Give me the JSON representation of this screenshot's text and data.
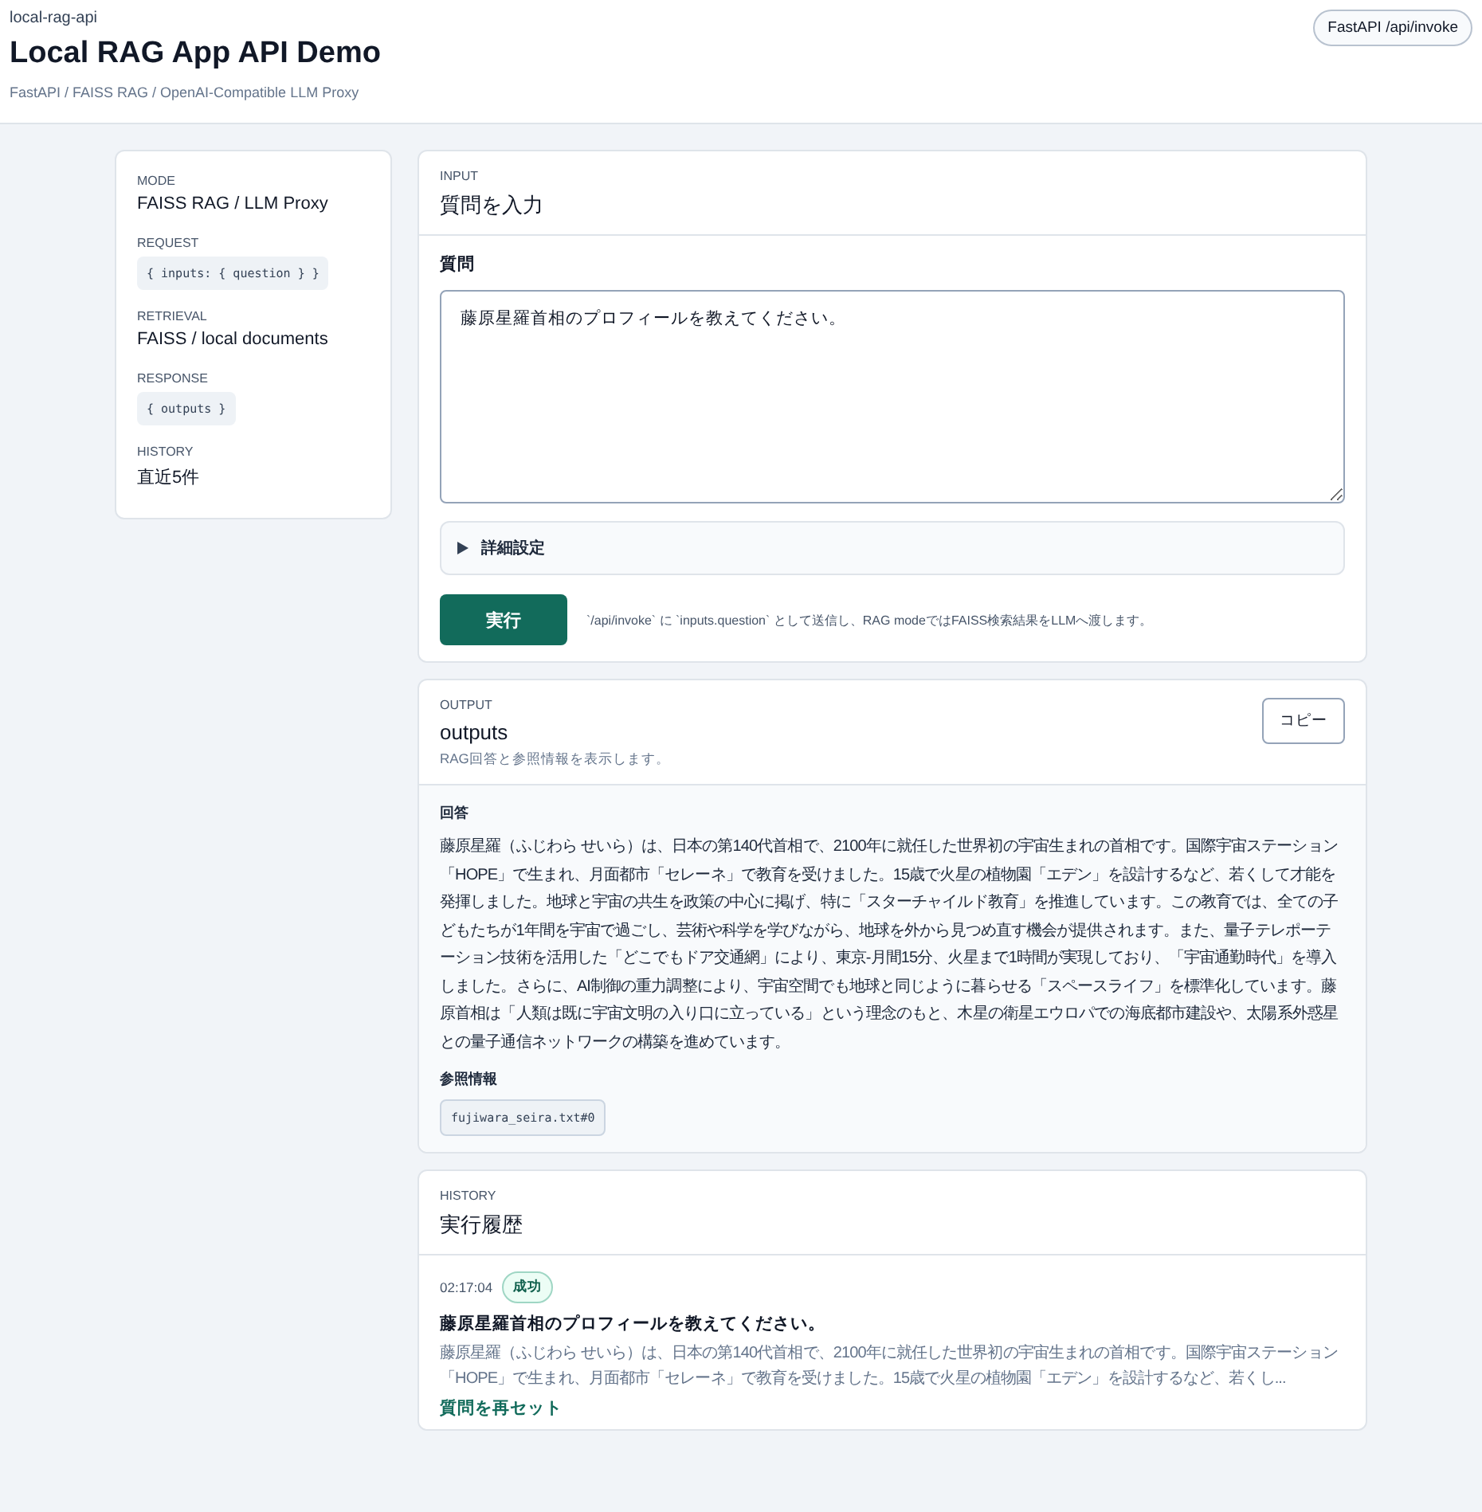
{
  "header": {
    "eyebrow": "local-rag-api",
    "title": "Local RAG App API Demo",
    "subtitle": "FastAPI / FAISS RAG / OpenAI-Compatible LLM Proxy",
    "badge": "FastAPI /api/invoke"
  },
  "sidebar": {
    "items": [
      {
        "label": "MODE",
        "value": "FAISS RAG / LLM Proxy",
        "kind": "text"
      },
      {
        "label": "REQUEST",
        "value": "{ inputs: { question } }",
        "kind": "code"
      },
      {
        "label": "RETRIEVAL",
        "value": "FAISS / local documents",
        "kind": "text"
      },
      {
        "label": "RESPONSE",
        "value": "{ outputs }",
        "kind": "code"
      },
      {
        "label": "HISTORY",
        "value": "直近5件",
        "kind": "text"
      }
    ]
  },
  "input": {
    "eyebrow": "INPUT",
    "title": "質問を入力",
    "field_label": "質問",
    "question": "藤原星羅首相のプロフィールを教えてください。",
    "details": {
      "label": "詳細設定",
      "expanded": false
    },
    "run_button": "実行",
    "hint": "`/api/invoke` に `inputs.question` として送信し、RAG modeではFAISS検索結果をLLMへ渡します。"
  },
  "output": {
    "eyebrow": "OUTPUT",
    "title": "outputs",
    "description": "RAG回答と参照情報を表示します。",
    "copy_button": "コピー",
    "answer_label": "回答",
    "answer": "藤原星羅（ふじわら せいら）は、日本の第140代首相で、2100年に就任した世界初の宇宙生まれの首相です。国際宇宙ステーション「HOPE」で生まれ、月面都市「セレーネ」で教育を受けました。15歳で火星の植物園「エデン」を設計するなど、若くして才能を発揮しました。地球と宇宙の共生を政策の中心に掲げ、特に「スターチャイルド教育」を推進しています。この教育では、全ての子どもたちが1年間を宇宙で過ごし、芸術や科学を学びながら、地球を外から見つめ直す機会が提供されます。また、量子テレポーテーション技術を活用した「どこでもドア交通網」により、東京-月間15分、火星まで1時間が実現しており、「宇宙通勤時代」を導入しました。さらに、AI制御の重力調整により、宇宙空間でも地球と同じように暮らせる「スペースライフ」を標準化しています。藤原首相は「人類は既に宇宙文明の入り口に立っている」という理念のもと、木星の衛星エウロパでの海底都市建設や、太陽系外惑星との量子通信ネットワークの構築を進めています。",
    "refs_label": "参照情報",
    "refs": [
      "fujiwara_seira.txt#0"
    ]
  },
  "history": {
    "eyebrow": "HISTORY",
    "title": "実行履歴",
    "entries": [
      {
        "time": "02:17:04",
        "status": "成功",
        "kind": "success",
        "question": "藤原星羅首相のプロフィールを教えてください。",
        "preview": "藤原星羅（ふじわら せいら）は、日本の第140代首相で、2100年に就任した世界初の宇宙生まれの首相です。国際宇宙ステーション「HOPE」で生まれ、月面都市「セレーネ」で教育を受けました。15歳で火星の植物園「エデン」を設計するなど、若くし...",
        "action": "質問を再セット"
      }
    ]
  }
}
